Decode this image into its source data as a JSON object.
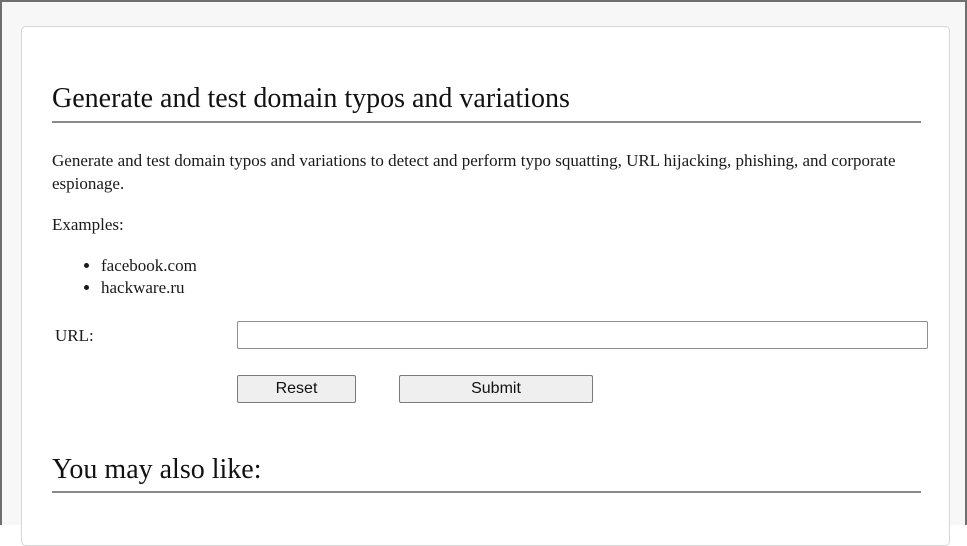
{
  "main": {
    "title": "Generate and test domain typos and variations",
    "description": "Generate and test domain typos and variations to detect and perform typo squatting, URL hijacking, phishing, and corporate espionage.",
    "examples_label": "Examples:",
    "examples": [
      "facebook.com",
      "hackware.ru"
    ]
  },
  "form": {
    "url_label": "URL:",
    "url_value": "",
    "url_placeholder": "",
    "reset_label": "Reset",
    "submit_label": "Submit"
  },
  "related": {
    "heading": "You may also like:"
  }
}
